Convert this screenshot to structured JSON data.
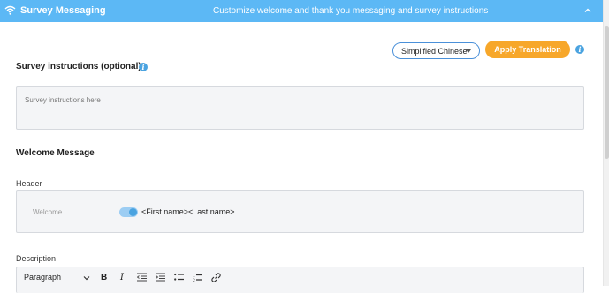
{
  "header": {
    "title": "Survey Messaging",
    "subtitle": "Customize welcome and thank you messaging and survey instructions",
    "icon": "wifi-icon",
    "collapse_icon": "chevron-up-icon",
    "color": "#5cb8f5"
  },
  "translation": {
    "language_selected": "Simplified Chinese",
    "apply_label": "Apply Translation",
    "apply_color": "#f7a72a"
  },
  "instructions": {
    "title": "Survey instructions (optional)",
    "placeholder": "Survey instructions here"
  },
  "welcome": {
    "title": "Welcome Message",
    "header_label": "Header",
    "header_default": "Welcome",
    "header_text": "<First name><Last name>",
    "toggle_on": true,
    "description_label": "Description"
  },
  "editor_toolbar": {
    "paragraph_label": "Paragraph",
    "bold": "B",
    "italic": "I"
  }
}
